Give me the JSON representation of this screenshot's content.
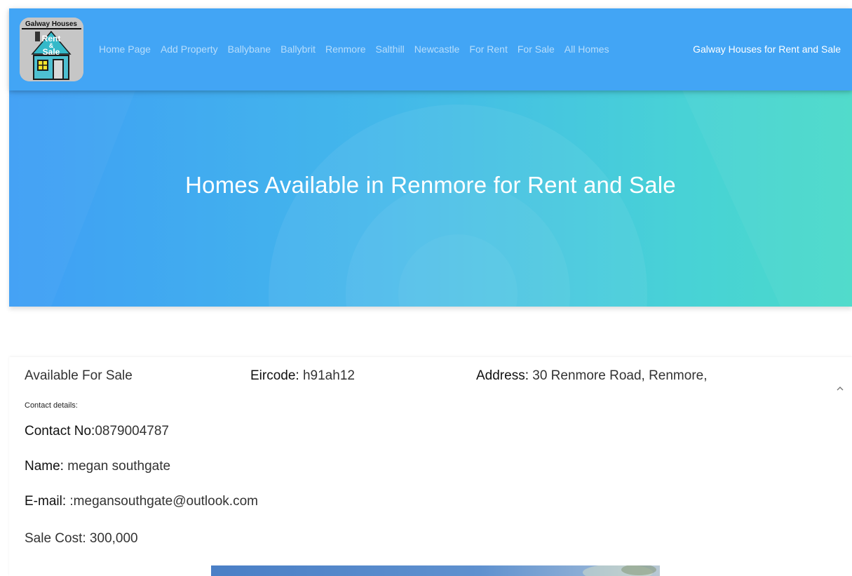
{
  "nav": {
    "logo": {
      "line1": "Galway Houses",
      "line2": "Rent",
      "line3": "&",
      "line4": "Sale",
      "icon": "house-icon"
    },
    "links": [
      "Home Page",
      "Add Property",
      "Ballybane",
      "Ballybrit",
      "Renmore",
      "Salthill",
      "Newcastle",
      "For Rent",
      "For Sale",
      "All Homes"
    ],
    "brand": "Galway Houses for Rent and Sale"
  },
  "hero": {
    "title": "Homes Available in Renmore for Rent and Sale"
  },
  "listing": {
    "status": "Available For Sale",
    "eircode_label": "Eircode:",
    "eircode_value": " h91ah12",
    "address_label": "Address:",
    "address_value": " 30 Renmore Road, Renmore,",
    "contact_heading": "Contact details:",
    "phone_label": "Contact No:",
    "phone_value": "0879004787",
    "name_label": "Name:",
    "name_value": " megan southgate",
    "email_label": "E-mail:",
    "email_value": " :megansouthgate@outlook.com",
    "cost_text": "Sale Cost: 300,000",
    "expand_icon": "chevron-up-icon"
  },
  "colors": {
    "navbar": "#42a5f5",
    "hero_start": "#3f9ff5",
    "hero_end": "#4adac9"
  }
}
